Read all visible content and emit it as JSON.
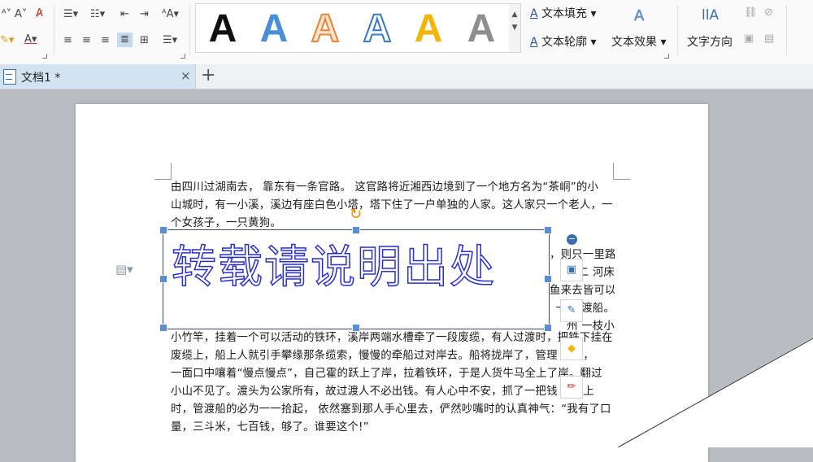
{
  "ribbon": {
    "wordart_gallery": [
      {
        "glyph": "A",
        "style": "black"
      },
      {
        "glyph": "A",
        "style": "blue"
      },
      {
        "glyph": "A",
        "style": "orange-outline"
      },
      {
        "glyph": "A",
        "style": "blue-outline"
      },
      {
        "glyph": "A",
        "style": "gold"
      },
      {
        "glyph": "A",
        "style": "gray-gradient"
      }
    ],
    "text_fill": "文本填充",
    "text_outline": "文本轮廓",
    "text_effect": "文本效果",
    "text_direction": "文字方向",
    "effect_icon": "A",
    "direction_icon": "llA"
  },
  "tabs": {
    "active_label": "文档1 *",
    "close": "×",
    "new_tab": "+"
  },
  "document": {
    "lines_before": [
      "由四川过湖南去， 靠东有一条官路。 这官路将近湘西边境到了一个地方名为“茶峒”的小",
      "山城时，有一小溪，溪边有座白色小塔，塔下住了一户单独的人家。这人家只一个老人，一",
      "个女孩子，一只黄狗。"
    ],
    "right_fragments": [
      "，则只一里路",
      "二 河床",
      "鱼来去皆可以",
      "一只 渡船。",
      "州 一枝小"
    ],
    "lines_after": [
      "小竹竿，挂着一个可以活动的铁环，溪岸两端水槽牵了一段废缆，有人过渡时，把铁下挂在",
      "废缆上，船上人就引手攀缘那条缆索，慢慢的牵船过对岸去。船将拢岸了，管理 船的，",
      "一面口中嚷着“慢点慢点”，自己霍的跃上了岸，拉着铁环，于是人货牛马全上了岸。翻过",
      "小山不见了。渡头为公家所有，故过渡人不必出钱。有人心中不安，抓了一把钱 船板上",
      "时，管渡船的必为一一拾起， 依然塞到那人手心里去，俨然吵嘴时的认真神气：“我有了口",
      "量，三斗米，七百钱，够了。谁要这个!”"
    ],
    "wordart_text": "转载请说明出处"
  },
  "colors": {
    "wordart_outline": "#2a2fc6",
    "handle": "#5b8dd4",
    "rotate": "#f08a00",
    "tab_active": "#d4e3f2"
  }
}
